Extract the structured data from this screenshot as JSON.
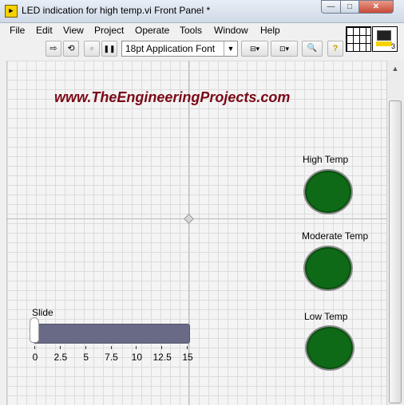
{
  "window": {
    "title": "LED indication for high temp.vi Front Panel *",
    "icon_text": "▶",
    "min_symbol": "—",
    "max_symbol": "□",
    "close_symbol": "✕"
  },
  "menu": [
    "File",
    "Edit",
    "View",
    "Project",
    "Operate",
    "Tools",
    "Window",
    "Help"
  ],
  "toolbar": {
    "run_icon": "⇨",
    "run_continuous_icon": "⟲",
    "abort_icon": "●",
    "pause_icon": "❚❚",
    "font_value": "18pt Application Font",
    "dropdown_arrow": "▼",
    "align_icon": "⊟▾",
    "distribute_icon": "⊡▾",
    "search_icon": "🔍",
    "help_icon": "?"
  },
  "vi_icon": {
    "terminal_count": "3"
  },
  "watermark": "www.TheEngineeringProjects.com",
  "leds": [
    {
      "label": "High Temp",
      "color": "#0f6a17"
    },
    {
      "label": "Moderate Temp",
      "color": "#0f6a17"
    },
    {
      "label": "Low Temp",
      "color": "#0f6a17"
    }
  ],
  "slide": {
    "label": "Slide",
    "value": 0,
    "min": 0,
    "max": 15,
    "ticks": [
      "0",
      "2.5",
      "5",
      "7.5",
      "10",
      "12.5",
      "15"
    ],
    "track_color": "#696a86"
  }
}
